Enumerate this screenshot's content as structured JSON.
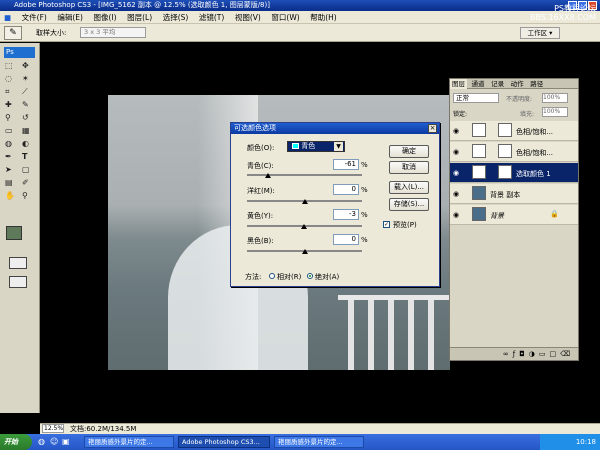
{
  "window": {
    "title": "Adobe Photoshop CS3 - [IMG_5162 副本 @ 12.5% (选取颜色 1, 图层蒙版/8)]",
    "watermark": "PS教程论坛 BBS.16XX8.COM"
  },
  "menu": [
    "文件(F)",
    "编辑(E)",
    "图像(I)",
    "图层(L)",
    "选择(S)",
    "滤镜(T)",
    "视图(V)",
    "窗口(W)",
    "帮助(H)"
  ],
  "options": {
    "sample_label": "取样大小:",
    "sample_value": "3 x 3 平均",
    "workspace": "工作区 ▾"
  },
  "dialog": {
    "title": "可选颜色选项",
    "color_label": "颜色(O):",
    "color_value": "青色",
    "rows": [
      {
        "label": "青色(C):",
        "value": "-61",
        "unit": "%"
      },
      {
        "label": "洋红(M):",
        "value": "0",
        "unit": "%"
      },
      {
        "label": "黄色(Y):",
        "value": "-3",
        "unit": "%"
      },
      {
        "label": "黑色(B):",
        "value": "0",
        "unit": "%"
      }
    ],
    "ok": "确定",
    "cancel": "取消",
    "load": "载入(L)...",
    "save": "存储(S)...",
    "preview": "预览(P)",
    "method_label": "方法:",
    "relative": "相对(R)",
    "absolute": "绝对(A)"
  },
  "layers": {
    "tabs": [
      "图层",
      "通道",
      "记录",
      "动作",
      "路径"
    ],
    "blend": "正常",
    "opacity_label": "不透明度:",
    "opacity": "100%",
    "lock_label": "锁定:",
    "fill_label": "填充:",
    "fill": "100%",
    "items": [
      {
        "name": "色相/饱和..."
      },
      {
        "name": "色相/饱和..."
      },
      {
        "name": "选取颜色 1"
      },
      {
        "name": "背景 副本"
      },
      {
        "name": "背景"
      }
    ]
  },
  "status": {
    "zoom": "12.5%",
    "doc": "文档:60.2M/134.5M"
  },
  "taskbar": {
    "start": "开始",
    "tasks": [
      "艳丽质感外景片的定...",
      "Adobe Photoshop CS3...",
      "艳丽质感外景片的定..."
    ],
    "clock": "10:18"
  }
}
